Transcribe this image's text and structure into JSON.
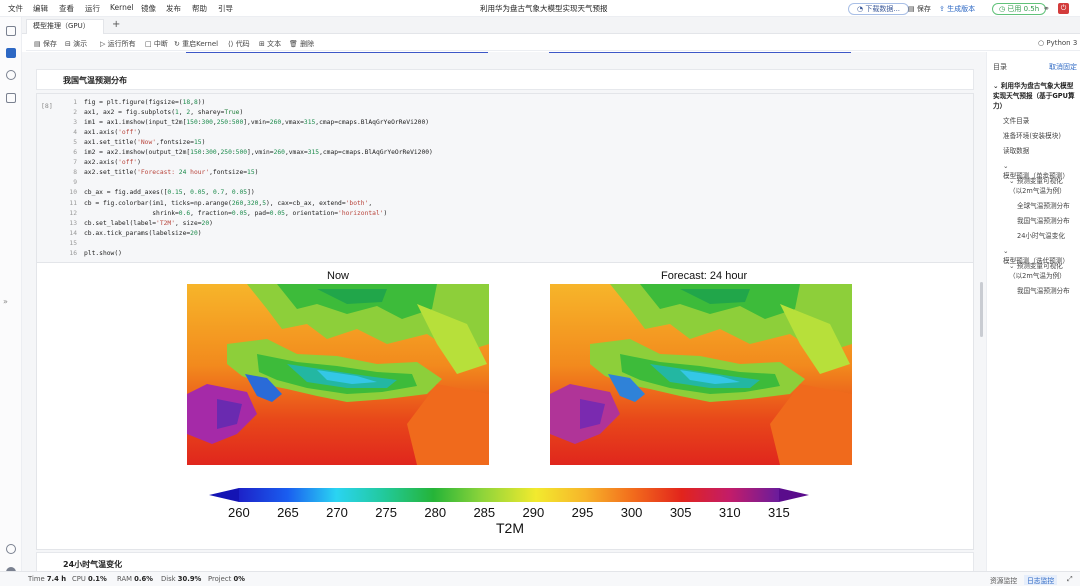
{
  "menu": [
    "文件",
    "编辑",
    "查看",
    "运行",
    "Kernel",
    "镜像",
    "发布",
    "帮助",
    "引导"
  ],
  "app_title": "利用华为盘古气象大模型实现天气预报",
  "header_actions": {
    "download": "下载数据...",
    "save": "保存",
    "generate": "生成版本",
    "usage": "已用 0.5h"
  },
  "tab": {
    "label": "模型推理（GPU）",
    "add": "+"
  },
  "toolbar": {
    "save": "保存",
    "present": "演示",
    "run_all": "运行所有",
    "interrupt": "中断",
    "restart": "重启Kernel",
    "code": "代码",
    "text": "文本",
    "delete": "删除",
    "kernel": "Python 3"
  },
  "notebook": {
    "section_title": "我国气温预测分布",
    "next_section_title": "24小时气温变化",
    "exec_count": "[8]",
    "code_lines": [
      {
        "n": "1",
        "t": "fig = plt.figure(figsize=(18,8))"
      },
      {
        "n": "2",
        "t": "ax1, ax2 = fig.subplots(1, 2, sharey=True)"
      },
      {
        "n": "3",
        "t": "im1 = ax1.imshow(input_t2m[150:300,250:500],vmin=260,vmax=315,cmap=cmaps.BlAqGrYeOrReVi200)"
      },
      {
        "n": "4",
        "t": "ax1.axis('off')"
      },
      {
        "n": "5",
        "t": "ax1.set_title('Now',fontsize=15)"
      },
      {
        "n": "6",
        "t": "im2 = ax2.imshow(output_t2m[150:300,250:500],vmin=260,vmax=315,cmap=cmaps.BlAqGrYeOrReVi200)"
      },
      {
        "n": "7",
        "t": "ax2.axis('off')"
      },
      {
        "n": "8",
        "t": "ax2.set_title('Forecast: 24 hour',fontsize=15)"
      },
      {
        "n": "9",
        "t": ""
      },
      {
        "n": "10",
        "t": "cb_ax = fig.add_axes([0.15, 0.05, 0.7, 0.05])"
      },
      {
        "n": "11",
        "t": "cb = fig.colorbar(im1, ticks=np.arange(260,320,5), cax=cb_ax, extend='both',"
      },
      {
        "n": "12",
        "t": "                  shrink=0.6, fraction=0.05, pad=0.05, orientation='horizontal')"
      },
      {
        "n": "13",
        "t": "cb.set_label(label='T2M', size=20)"
      },
      {
        "n": "14",
        "t": "cb.ax.tick_params(labelsize=20)"
      },
      {
        "n": "15",
        "t": ""
      },
      {
        "n": "16",
        "t": "plt.show()"
      }
    ]
  },
  "plot": {
    "titles": [
      "Now",
      "Forecast: 24 hour"
    ],
    "colorbar_ticks": [
      "260",
      "265",
      "270",
      "275",
      "280",
      "285",
      "290",
      "295",
      "300",
      "305",
      "310",
      "315"
    ],
    "colorbar_label": "T2M",
    "vmin": 260,
    "vmax": 315
  },
  "sidebar": {
    "title": "目录",
    "unpin": "取消固定",
    "items": [
      {
        "label": "利用华为盘古气象大模型实现天气预报（基于GPU算力）",
        "level": 0,
        "bold": true,
        "caret": true
      },
      {
        "label": "文件目录",
        "level": 1
      },
      {
        "label": "准备环境(安装模块)",
        "level": 1
      },
      {
        "label": "读取数据",
        "level": 1
      },
      {
        "label": "模型预测（单步预测）",
        "level": 1,
        "caret": true
      },
      {
        "label": "预测变量可视化（以2m气温为例）",
        "level": 2,
        "caret": true
      },
      {
        "label": "全球气温预测分布",
        "level": 3
      },
      {
        "label": "我国气温预测分布",
        "level": 3
      },
      {
        "label": "24小时气温变化",
        "level": 3
      },
      {
        "label": "模型预测（迭代预测）",
        "level": 1,
        "caret": true
      },
      {
        "label": "预测变量可视化（以2m气温为例）",
        "level": 2,
        "caret": true
      },
      {
        "label": "我国气温预测分布",
        "level": 3
      }
    ]
  },
  "status": {
    "time_label": "Time",
    "time": "7.4 h",
    "cpu_label": "CPU",
    "cpu": "0.1%",
    "ram_label": "RAM",
    "ram": "0.6%",
    "disk_label": "Disk",
    "disk": "30.9%",
    "project_label": "Project",
    "project": "0%",
    "monitor": "资源监控",
    "log": "日志监控"
  },
  "colors": {
    "accent": "#2d68c4",
    "green": "#2f9b4b",
    "red": "#d33c3c"
  }
}
